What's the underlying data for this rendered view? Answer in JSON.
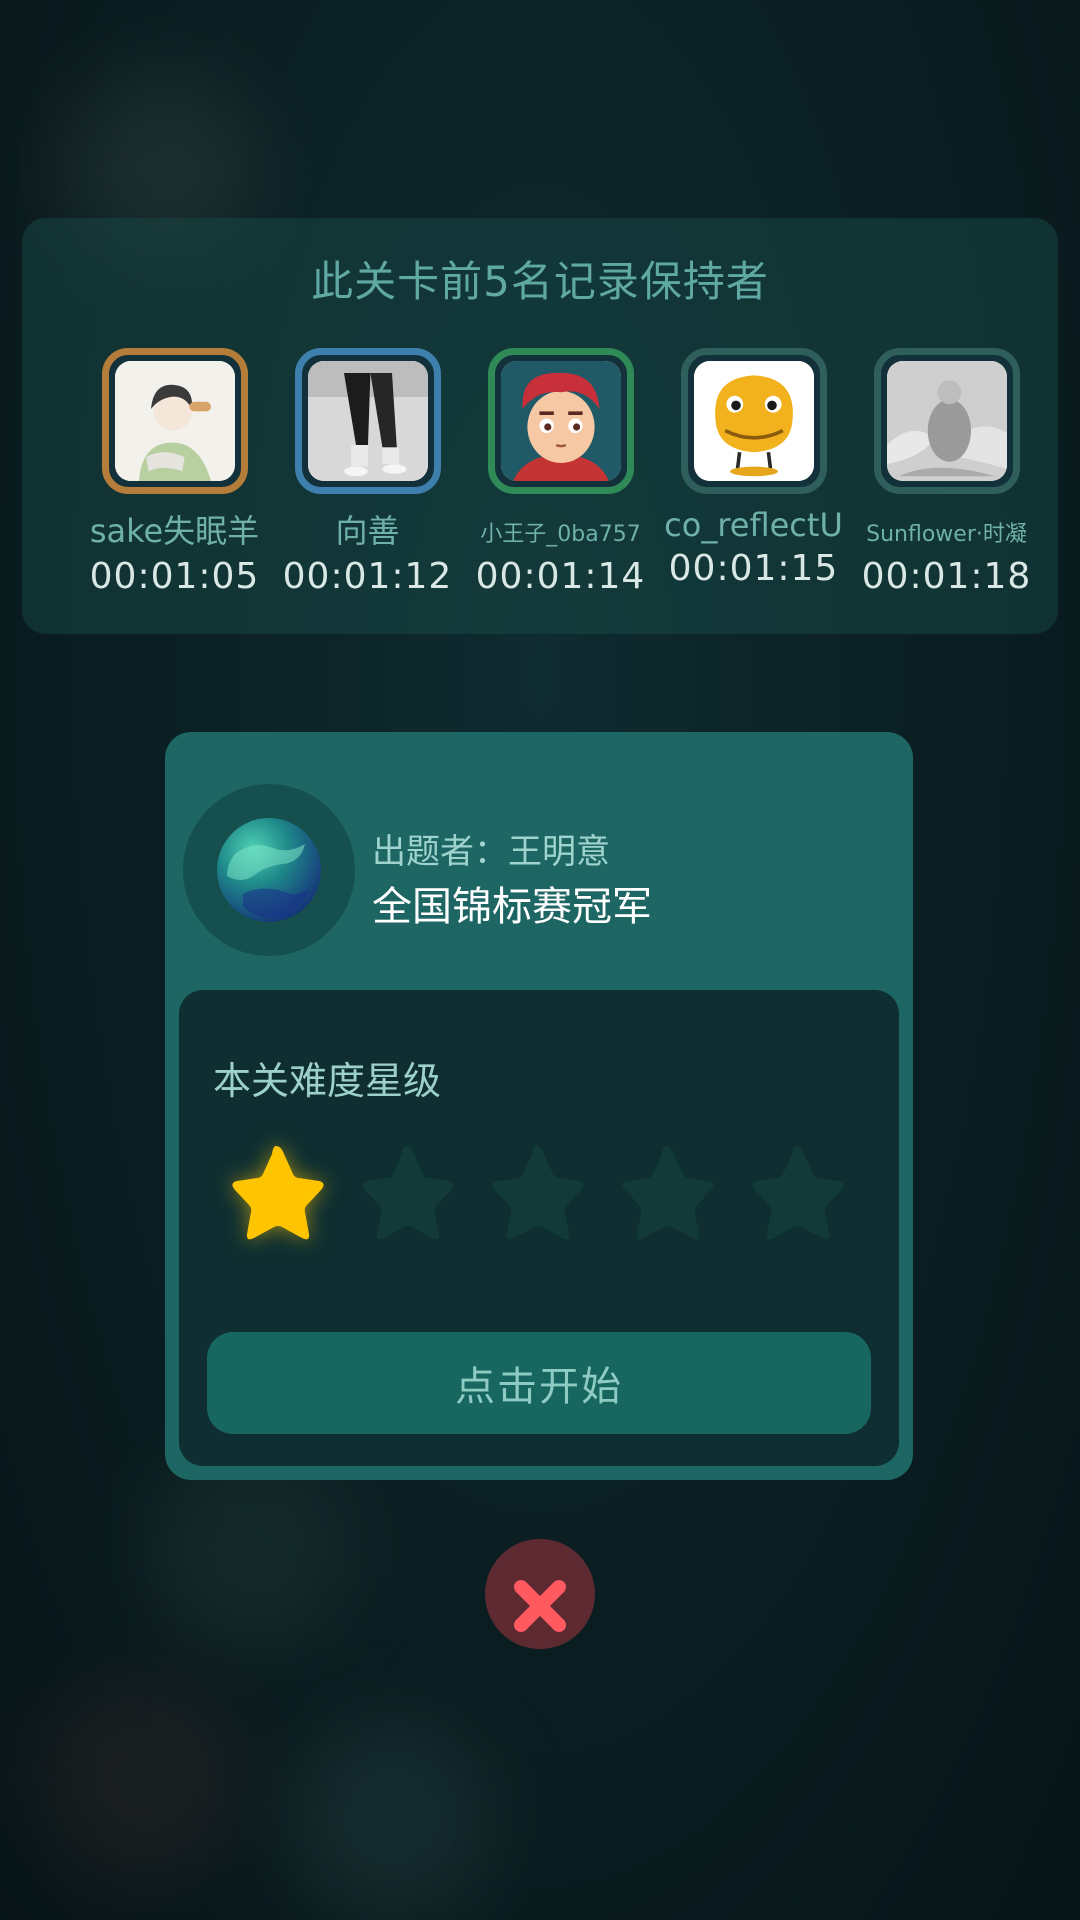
{
  "records": {
    "title": "此关卡前5名记录保持者",
    "holders": [
      {
        "name": "sake失眠羊",
        "time": "00:01:05",
        "frame_color": "#b57d3a",
        "avatar": "person-eating-avatar"
      },
      {
        "name": "向善",
        "time": "00:01:12",
        "frame_color": "#3f7fae",
        "avatar": "legs-walking-avatar"
      },
      {
        "name": "小王子_0ba757",
        "time": "00:01:14",
        "frame_color": "#2f8a57",
        "avatar": "cartoon-boy-avatar"
      },
      {
        "name": "co_reflectU",
        "time": "00:01:15",
        "frame_color": "#2f5f5c",
        "avatar": "yellow-dinosaur-avatar"
      },
      {
        "name": "Sunflower·时凝",
        "time": "00:01:18",
        "frame_color": "#2f5f5c",
        "avatar": "wolves-photo-avatar"
      }
    ]
  },
  "level": {
    "author_label": "出题者：王明意",
    "author_title": "全国锦标赛冠军",
    "author_icon": "planet-icon",
    "difficulty_label": "本关难度星级",
    "difficulty_stars": 1,
    "difficulty_max": 5,
    "star_on_color": "#ffc400",
    "star_off_color": "#123a39",
    "start_label": "点击开始"
  },
  "close": {
    "icon": "close-icon",
    "color": "#ff5a5f"
  }
}
